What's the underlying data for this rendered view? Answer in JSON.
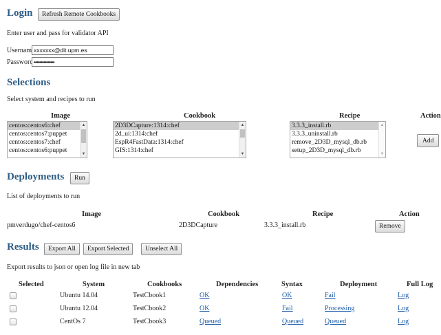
{
  "login": {
    "heading": "Login",
    "refresh_button": "Refresh Remote Cookbooks",
    "instruction": "Enter user and pass for validator API",
    "username_label": "Username:",
    "username_value": "xxxxxxx@dit.upm.es",
    "password_label": "Password:",
    "password_value": "•••••••••••••••"
  },
  "selections": {
    "heading": "Selections",
    "instruction": "Select system and recipes to run",
    "image_header": "Image",
    "cookbook_header": "Cookbook",
    "recipe_header": "Recipe",
    "action_header": "Action",
    "images": [
      "centos:centos6:chef",
      "centos:centos7:puppet",
      "centos:centos7:chef",
      "centos:centos6:puppet"
    ],
    "cookbooks": [
      "2D3DCapture:1314:chef",
      "2d_ui:1314:chef",
      "EspR4FastData:1314:chef",
      "GIS:1314:chef"
    ],
    "recipes": [
      "3.3.3_install.rb",
      "3.3.3_uninstall.rb",
      "remove_2D3D_mysql_db.rb",
      "setup_2D3D_mysql_db.rb"
    ],
    "add_button": "Add"
  },
  "deployments": {
    "heading": "Deployments",
    "run_button": "Run",
    "instruction": "List of deployments to run",
    "headers": {
      "image": "Image",
      "cookbook": "Cookbook",
      "recipe": "Recipe",
      "action": "Action"
    },
    "rows": [
      {
        "image": "pmverdugo/chef-centos6",
        "cookbook": "2D3DCapture",
        "recipe": "3.3.3_install.rb",
        "action": "Remove"
      }
    ]
  },
  "results": {
    "heading": "Results",
    "export_all_button": "Export All",
    "export_selected_button": "Export Selected",
    "unselect_all_button": "Unselect All",
    "instruction": "Export results to json or open log file in new tab",
    "headers": {
      "selected": "Selected",
      "system": "System",
      "cookbooks": "Cookbooks",
      "dependencies": "Dependencies",
      "syntax": "Syntax",
      "deployment": "Deployment",
      "full_log": "Full Log"
    },
    "rows": [
      {
        "system": "Ubuntu 14.04",
        "cookbook": "TestCbook1",
        "dependencies": "OK",
        "syntax": "OK",
        "deployment": "Fail",
        "log": "Log"
      },
      {
        "system": "Ubuntu 12.04",
        "cookbook": "TestCbook2",
        "dependencies": "OK",
        "syntax": "Fail",
        "deployment": "Processing",
        "log": "Log"
      },
      {
        "system": "CentOs 7",
        "cookbook": "TestCbook3",
        "dependencies": "Queued",
        "syntax": "Queued",
        "deployment": "Queued",
        "log": "Log"
      }
    ]
  }
}
